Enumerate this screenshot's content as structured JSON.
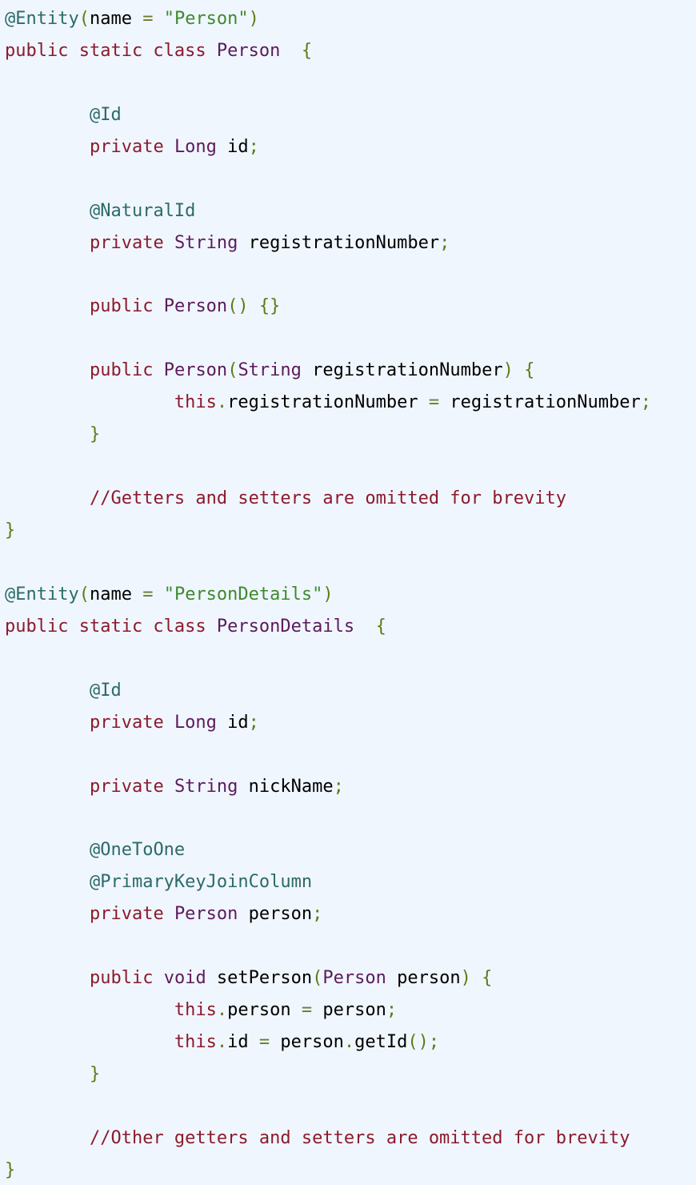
{
  "code": {
    "lines": [
      [
        {
          "t": "@Entity",
          "k": "annotation"
        },
        {
          "t": "(",
          "k": "punct"
        },
        {
          "t": "name ",
          "k": "plain"
        },
        {
          "t": "=",
          "k": "operator"
        },
        {
          "t": " ",
          "k": "plain"
        },
        {
          "t": "\"Person\"",
          "k": "string"
        },
        {
          "t": ")",
          "k": "punct"
        }
      ],
      [
        {
          "t": "public static class",
          "k": "keyword"
        },
        {
          "t": " ",
          "k": "plain"
        },
        {
          "t": "Person",
          "k": "type"
        },
        {
          "t": "  ",
          "k": "plain"
        },
        {
          "t": "{",
          "k": "punct"
        }
      ],
      [],
      [
        {
          "t": "        ",
          "k": "plain"
        },
        {
          "t": "@Id",
          "k": "annotation"
        }
      ],
      [
        {
          "t": "        ",
          "k": "plain"
        },
        {
          "t": "private",
          "k": "keyword"
        },
        {
          "t": " ",
          "k": "plain"
        },
        {
          "t": "Long",
          "k": "type"
        },
        {
          "t": " id",
          "k": "plain"
        },
        {
          "t": ";",
          "k": "punct"
        }
      ],
      [],
      [
        {
          "t": "        ",
          "k": "plain"
        },
        {
          "t": "@NaturalId",
          "k": "annotation"
        }
      ],
      [
        {
          "t": "        ",
          "k": "plain"
        },
        {
          "t": "private",
          "k": "keyword"
        },
        {
          "t": " ",
          "k": "plain"
        },
        {
          "t": "String",
          "k": "type"
        },
        {
          "t": " registrationNumber",
          "k": "plain"
        },
        {
          "t": ";",
          "k": "punct"
        }
      ],
      [],
      [
        {
          "t": "        ",
          "k": "plain"
        },
        {
          "t": "public",
          "k": "keyword"
        },
        {
          "t": " ",
          "k": "plain"
        },
        {
          "t": "Person",
          "k": "type"
        },
        {
          "t": "() {}",
          "k": "punct"
        }
      ],
      [],
      [
        {
          "t": "        ",
          "k": "plain"
        },
        {
          "t": "public",
          "k": "keyword"
        },
        {
          "t": " ",
          "k": "plain"
        },
        {
          "t": "Person",
          "k": "type"
        },
        {
          "t": "(",
          "k": "punct"
        },
        {
          "t": "String",
          "k": "type"
        },
        {
          "t": " registrationNumber",
          "k": "plain"
        },
        {
          "t": ") {",
          "k": "punct"
        }
      ],
      [
        {
          "t": "                ",
          "k": "plain"
        },
        {
          "t": "this",
          "k": "keyword"
        },
        {
          "t": ".",
          "k": "punct"
        },
        {
          "t": "registrationNumber ",
          "k": "plain"
        },
        {
          "t": "=",
          "k": "operator"
        },
        {
          "t": " registrationNumber",
          "k": "plain"
        },
        {
          "t": ";",
          "k": "punct"
        }
      ],
      [
        {
          "t": "        ",
          "k": "plain"
        },
        {
          "t": "}",
          "k": "punct"
        }
      ],
      [],
      [
        {
          "t": "        ",
          "k": "plain"
        },
        {
          "t": "//Getters and setters are omitted for brevity",
          "k": "comment"
        }
      ],
      [
        {
          "t": "}",
          "k": "punct"
        }
      ],
      [],
      [
        {
          "t": "@Entity",
          "k": "annotation"
        },
        {
          "t": "(",
          "k": "punct"
        },
        {
          "t": "name ",
          "k": "plain"
        },
        {
          "t": "=",
          "k": "operator"
        },
        {
          "t": " ",
          "k": "plain"
        },
        {
          "t": "\"PersonDetails\"",
          "k": "string"
        },
        {
          "t": ")",
          "k": "punct"
        }
      ],
      [
        {
          "t": "public static class",
          "k": "keyword"
        },
        {
          "t": " ",
          "k": "plain"
        },
        {
          "t": "PersonDetails",
          "k": "type"
        },
        {
          "t": "  ",
          "k": "plain"
        },
        {
          "t": "{",
          "k": "punct"
        }
      ],
      [],
      [
        {
          "t": "        ",
          "k": "plain"
        },
        {
          "t": "@Id",
          "k": "annotation"
        }
      ],
      [
        {
          "t": "        ",
          "k": "plain"
        },
        {
          "t": "private",
          "k": "keyword"
        },
        {
          "t": " ",
          "k": "plain"
        },
        {
          "t": "Long",
          "k": "type"
        },
        {
          "t": " id",
          "k": "plain"
        },
        {
          "t": ";",
          "k": "punct"
        }
      ],
      [],
      [
        {
          "t": "        ",
          "k": "plain"
        },
        {
          "t": "private",
          "k": "keyword"
        },
        {
          "t": " ",
          "k": "plain"
        },
        {
          "t": "String",
          "k": "type"
        },
        {
          "t": " nickName",
          "k": "plain"
        },
        {
          "t": ";",
          "k": "punct"
        }
      ],
      [],
      [
        {
          "t": "        ",
          "k": "plain"
        },
        {
          "t": "@OneToOne",
          "k": "annotation"
        }
      ],
      [
        {
          "t": "        ",
          "k": "plain"
        },
        {
          "t": "@PrimaryKeyJoinColumn",
          "k": "annotation"
        }
      ],
      [
        {
          "t": "        ",
          "k": "plain"
        },
        {
          "t": "private",
          "k": "keyword"
        },
        {
          "t": " ",
          "k": "plain"
        },
        {
          "t": "Person",
          "k": "type"
        },
        {
          "t": " person",
          "k": "plain"
        },
        {
          "t": ";",
          "k": "punct"
        }
      ],
      [],
      [
        {
          "t": "        ",
          "k": "plain"
        },
        {
          "t": "public",
          "k": "keyword"
        },
        {
          "t": " ",
          "k": "plain"
        },
        {
          "t": "void",
          "k": "type"
        },
        {
          "t": " setPerson",
          "k": "plain"
        },
        {
          "t": "(",
          "k": "punct"
        },
        {
          "t": "Person",
          "k": "type"
        },
        {
          "t": " person",
          "k": "plain"
        },
        {
          "t": ") {",
          "k": "punct"
        }
      ],
      [
        {
          "t": "                ",
          "k": "plain"
        },
        {
          "t": "this",
          "k": "keyword"
        },
        {
          "t": ".",
          "k": "punct"
        },
        {
          "t": "person ",
          "k": "plain"
        },
        {
          "t": "=",
          "k": "operator"
        },
        {
          "t": " person",
          "k": "plain"
        },
        {
          "t": ";",
          "k": "punct"
        }
      ],
      [
        {
          "t": "                ",
          "k": "plain"
        },
        {
          "t": "this",
          "k": "keyword"
        },
        {
          "t": ".",
          "k": "punct"
        },
        {
          "t": "id ",
          "k": "plain"
        },
        {
          "t": "=",
          "k": "operator"
        },
        {
          "t": " person",
          "k": "plain"
        },
        {
          "t": ".",
          "k": "punct"
        },
        {
          "t": "getId",
          "k": "plain"
        },
        {
          "t": "();",
          "k": "punct"
        }
      ],
      [
        {
          "t": "        ",
          "k": "plain"
        },
        {
          "t": "}",
          "k": "punct"
        }
      ],
      [],
      [
        {
          "t": "        ",
          "k": "plain"
        },
        {
          "t": "//Other getters and setters are omitted for brevity",
          "k": "comment"
        }
      ],
      [
        {
          "t": "}",
          "k": "punct"
        }
      ]
    ]
  }
}
